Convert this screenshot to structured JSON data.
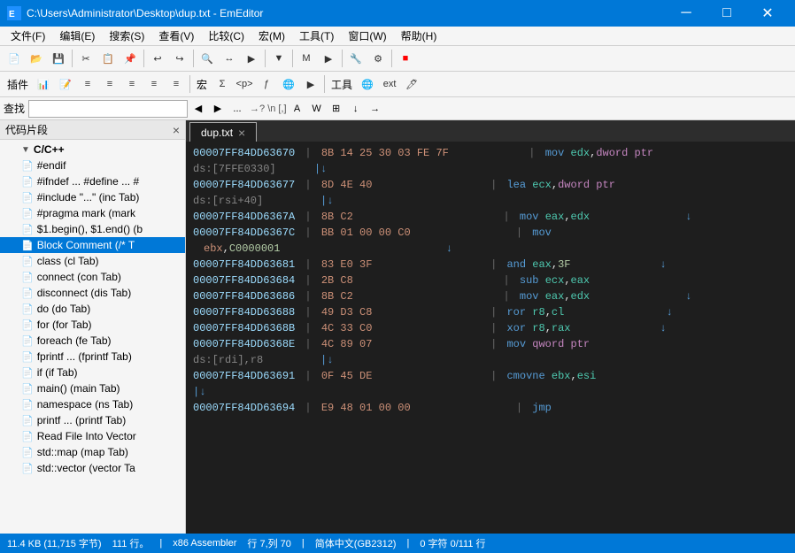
{
  "titleBar": {
    "text": "C:\\Users\\Administrator\\Desktop\\dup.txt - EmEditor",
    "minimizeLabel": "─",
    "maximizeLabel": "□",
    "closeLabel": "✕"
  },
  "menuBar": {
    "items": [
      "文件(F)",
      "编辑(E)",
      "搜索(S)",
      "查看(V)",
      "比较(C)",
      "宏(M)",
      "工具(T)",
      "窗口(W)",
      "帮助(H)"
    ]
  },
  "searchBar": {
    "label": "查找",
    "placeholder": ""
  },
  "sidebar": {
    "title": "代码片段",
    "items": [
      {
        "label": "C/C++",
        "type": "group",
        "expanded": true
      },
      {
        "label": "#endif",
        "type": "item",
        "indent": 1
      },
      {
        "label": "#ifndef ... #define ... #",
        "type": "item",
        "indent": 1
      },
      {
        "label": "#include \"...\" (inc Tab)",
        "type": "item",
        "indent": 1
      },
      {
        "label": "#pragma mark (mark",
        "type": "item",
        "indent": 1
      },
      {
        "label": "$1.begin(), $1.end() (b",
        "type": "item",
        "indent": 1
      },
      {
        "label": "Block Comment (/* T",
        "type": "item",
        "indent": 1
      },
      {
        "label": "class (cl Tab)",
        "type": "item",
        "indent": 1
      },
      {
        "label": "connect (con Tab)",
        "type": "item",
        "indent": 1
      },
      {
        "label": "disconnect (dis Tab)",
        "type": "item",
        "indent": 1
      },
      {
        "label": "do (do Tab)",
        "type": "item",
        "indent": 1
      },
      {
        "label": "for (for Tab)",
        "type": "item",
        "indent": 1
      },
      {
        "label": "foreach (fe Tab)",
        "type": "item",
        "indent": 1
      },
      {
        "label": "fprintf ... (fprintf Tab)",
        "type": "item",
        "indent": 1
      },
      {
        "label": "if (if Tab)",
        "type": "item",
        "indent": 1
      },
      {
        "label": "main() (main Tab)",
        "type": "item",
        "indent": 1
      },
      {
        "label": "namespace  (ns Tab)",
        "type": "item",
        "indent": 1
      },
      {
        "label": "printf ... (printf Tab)",
        "type": "item",
        "indent": 1
      },
      {
        "label": "Read File Into Vector",
        "type": "item",
        "indent": 1
      },
      {
        "label": "std::map (map Tab)",
        "type": "item",
        "indent": 1
      },
      {
        "label": "std::vector (vector Ta",
        "type": "item",
        "indent": 1
      }
    ]
  },
  "editor": {
    "tabName": "dup.txt",
    "lines": [
      {
        "addr": "00007FF84DD63670",
        "hex": "8B 14 25 30 03 FE 7F",
        "spaces": "           ",
        "asm": "| mov edx,dword ptr"
      },
      {
        "addr": "ds:[7FFE0330]",
        "hex": "",
        "spaces": "",
        "asm": "     |↓"
      },
      {
        "addr": "00007FF84DD63677",
        "hex": "8D 4E 40",
        "spaces": "                 ",
        "asm": "| lea ecx,dword ptr"
      },
      {
        "addr": "ds:[rsi+40]",
        "hex": "",
        "spaces": "",
        "asm": "         |↓"
      },
      {
        "addr": "00007FF84DD6367A",
        "hex": "8B C2",
        "spaces": "                      ",
        "asm": "| mov eax,edx",
        "arrow": "↓"
      },
      {
        "addr": "00007FF84DD6367C",
        "hex": "BB 01 00 00 C0",
        "spaces": "               ",
        "asm": "| mov",
        "cont": "ebx,C0000001",
        "arrow2": "↓"
      },
      {
        "addr": "00007FF84DD63681",
        "hex": "83 E0 3F",
        "spaces": "                 ",
        "asm": "| and eax,3F",
        "arrow": "↓"
      },
      {
        "addr": "00007FF84DD63684",
        "hex": "2B C8",
        "spaces": "                      ",
        "asm": "| sub ecx,eax"
      },
      {
        "addr": "00007FF84DD63686",
        "hex": "8B C2",
        "spaces": "                      ",
        "asm": "| mov eax,edx",
        "arrow": "↓"
      },
      {
        "addr": "00007FF84DD63688",
        "hex": "49 D3 C8",
        "spaces": "                 ",
        "asm": "| ror r8,cl",
        "arrow": "↓"
      },
      {
        "addr": "00007FF84DD6368B",
        "hex": "4C 33 C0",
        "spaces": "                 ",
        "asm": "| xor r8,rax",
        "arrow": "↓"
      },
      {
        "addr": "00007FF84DD6368E",
        "hex": "4C 89 07",
        "spaces": "                 ",
        "asm": "| mov qword ptr"
      },
      {
        "addr": "ds:[rdi],r8",
        "hex": "",
        "spaces": "",
        "asm": "         |↓"
      },
      {
        "addr": "00007FF84DD63691",
        "hex": "0F 45 DE",
        "spaces": "                 ",
        "asm": "| cmovne ebx,esi"
      },
      {
        "addr": "",
        "hex": "|↓",
        "spaces": "",
        "asm": ""
      },
      {
        "addr": "00007FF84DD63694",
        "hex": "E9 48 01 00 00",
        "spaces": "               ",
        "asm": "| jmp"
      }
    ]
  },
  "statusBar": {
    "fileSize": "11.4 KB (11,715 字节)",
    "lines": "111 行。",
    "encoding": "x86 Assembler",
    "position": "行 7,列 70",
    "charSet": "简体中文(GB2312)",
    "selection": "0 字符 0/111 行"
  }
}
